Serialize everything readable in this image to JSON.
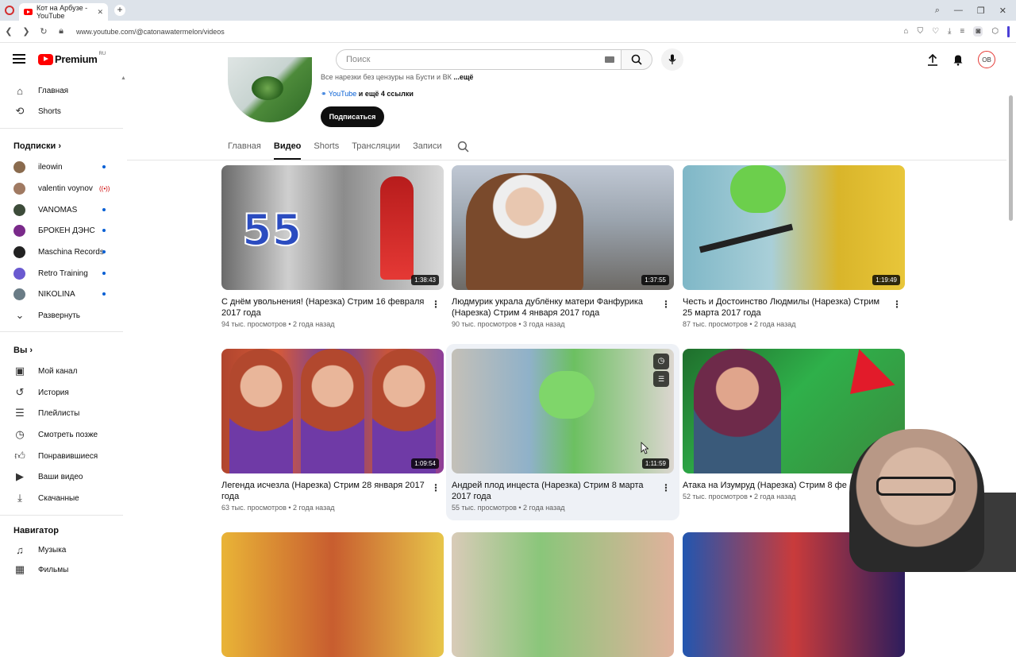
{
  "browser": {
    "tab_title": "Кот на Арбузе - YouTube",
    "tab_close": "✕",
    "new_tab": "+",
    "url": "www.youtube.com/@catonawatermelon/videos"
  },
  "header": {
    "logo_text": "Premium",
    "logo_region": "RU",
    "search_placeholder": "Поиск",
    "avatar_initials": "OB"
  },
  "sidebar": {
    "main_items": [
      {
        "label": "Главная",
        "icon": "home-icon"
      },
      {
        "label": "Shorts",
        "icon": "shorts-icon"
      }
    ],
    "subscriptions_title": "Подписки",
    "subscriptions": [
      {
        "label": "ileowin",
        "status": "new",
        "color": "#8a6b4e"
      },
      {
        "label": "valentin voynov",
        "status": "live",
        "color": "#a07a62"
      },
      {
        "label": "VANOMAS",
        "status": "new",
        "color": "#3d4c3a"
      },
      {
        "label": "БРОКЕН ДЭНС",
        "status": "new",
        "color": "#7a2a8a"
      },
      {
        "label": "Maschina Records",
        "status": "new",
        "color": "#222222"
      },
      {
        "label": "Retro Training",
        "status": "new",
        "color": "#6a5ad0"
      },
      {
        "label": "NIKOLINA",
        "status": "new",
        "color": "#6a7c86"
      }
    ],
    "expand_label": "Развернуть",
    "you_title": "Вы",
    "you_items": [
      {
        "label": "Мой канал",
        "icon": "my-channel-icon"
      },
      {
        "label": "История",
        "icon": "history-icon"
      },
      {
        "label": "Плейлисты",
        "icon": "playlists-icon"
      },
      {
        "label": "Смотреть позже",
        "icon": "watch-later-icon"
      },
      {
        "label": "Понравившиеся",
        "icon": "like-icon"
      },
      {
        "label": "Ваши видео",
        "icon": "your-videos-icon"
      },
      {
        "label": "Скачанные",
        "icon": "downloads-icon"
      }
    ],
    "navigator_title": "Навигатор",
    "navigator_items": [
      {
        "label": "Музыка",
        "icon": "music-icon"
      },
      {
        "label": "Фильмы",
        "icon": "movies-icon"
      }
    ]
  },
  "channel": {
    "description": "Все нарезки без цензуры на Бусти и ВК",
    "more": "...ещё",
    "link_label": "YouTube",
    "more_links": "и ещё 4 ссылки",
    "subscribe_label": "Подписаться",
    "tabs": [
      "Главная",
      "Видео",
      "Shorts",
      "Трансляции",
      "Записи"
    ],
    "active_tab": "Видео"
  },
  "videos": [
    {
      "title": "С днём увольнения! (Нарезка) Стрим 16 февраля 2017 года",
      "meta": "94 тыс. просмотров • 2 года назад",
      "duration": "1:38:43",
      "num": "55"
    },
    {
      "title": "Людмурик украла дублёнку матери Фанфурика (Нарезка) Стрим 4 января 2017 года",
      "meta": "90 тыс. просмотров • 3 года назад",
      "duration": "1:37:55"
    },
    {
      "title": "Честь и Достоинство Людмилы (Нарезка) Стрим 25 марта 2017 года",
      "meta": "87 тыс. просмотров • 2 года назад",
      "duration": "1:19:49"
    },
    {
      "title": "Легенда исчезла (Нарезка) Стрим 28 января 2017 года",
      "meta": "63 тыс. просмотров • 2 года назад",
      "duration": "1:09:54"
    },
    {
      "title": "Андрей плод инцеста (Нарезка) Стрим 8 марта 2017 года",
      "meta": "55 тыс. просмотров • 2 года назад",
      "duration": "1:11:59"
    },
    {
      "title": "Атака на Изумруд (Нарезка) Стрим 8 фе",
      "meta": "52 тыс. просмотров • 2 года назад",
      "duration": ""
    }
  ]
}
